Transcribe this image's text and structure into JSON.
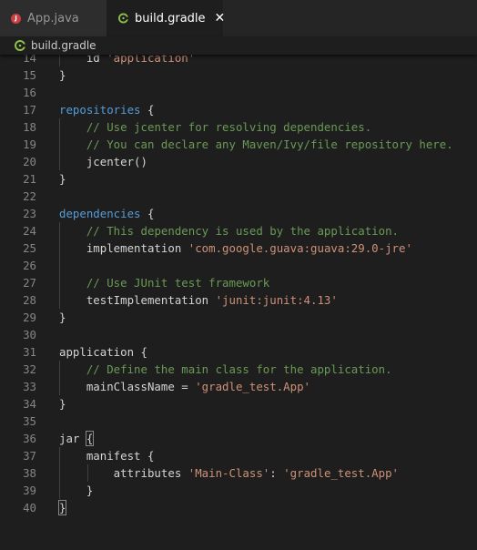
{
  "tabs": [
    {
      "label": "App.java",
      "icon": "java-file-icon",
      "icon_glyph": "J",
      "active": false
    },
    {
      "label": "build.gradle",
      "icon": "gradle-file-icon",
      "icon_glyph": "",
      "active": true,
      "close_glyph": "✕"
    }
  ],
  "breadcrumb": {
    "label": "build.gradle"
  },
  "colors": {
    "keyword": "#569cd6",
    "string": "#ce9178",
    "comment": "#6a9955",
    "text": "#d4d4d4",
    "line_number": "#858585",
    "gradle_icon": "#8dc149",
    "java_icon": "#cc3e44"
  },
  "code_lines": [
    {
      "num": "14",
      "tokens": [
        {
          "t": "    id ",
          "c": "pl"
        },
        {
          "t": "'application'",
          "c": "str"
        }
      ]
    },
    {
      "num": "15",
      "tokens": [
        {
          "t": "}",
          "c": "pl"
        }
      ]
    },
    {
      "num": "16",
      "tokens": []
    },
    {
      "num": "17",
      "tokens": [
        {
          "t": "repositories",
          "c": "kw"
        },
        {
          "t": " {",
          "c": "pl"
        }
      ]
    },
    {
      "num": "18",
      "tokens": [
        {
          "t": "    ",
          "c": "pl"
        },
        {
          "t": "// Use jcenter for resolving dependencies.",
          "c": "cm"
        }
      ]
    },
    {
      "num": "19",
      "tokens": [
        {
          "t": "    ",
          "c": "pl"
        },
        {
          "t": "// You can declare any Maven/Ivy/file repository here.",
          "c": "cm"
        }
      ]
    },
    {
      "num": "20",
      "tokens": [
        {
          "t": "    jcenter()",
          "c": "pl"
        }
      ]
    },
    {
      "num": "21",
      "tokens": [
        {
          "t": "}",
          "c": "pl"
        }
      ]
    },
    {
      "num": "22",
      "tokens": []
    },
    {
      "num": "23",
      "tokens": [
        {
          "t": "dependencies",
          "c": "kw"
        },
        {
          "t": " {",
          "c": "pl"
        }
      ]
    },
    {
      "num": "24",
      "tokens": [
        {
          "t": "    ",
          "c": "pl"
        },
        {
          "t": "// This dependency is used by the application.",
          "c": "cm"
        }
      ]
    },
    {
      "num": "25",
      "tokens": [
        {
          "t": "    implementation ",
          "c": "pl"
        },
        {
          "t": "'com.google.guava:guava:29.0-jre'",
          "c": "str"
        }
      ]
    },
    {
      "num": "26",
      "tokens": []
    },
    {
      "num": "27",
      "tokens": [
        {
          "t": "    ",
          "c": "pl"
        },
        {
          "t": "// Use JUnit test framework",
          "c": "cm"
        }
      ]
    },
    {
      "num": "28",
      "tokens": [
        {
          "t": "    testImplementation ",
          "c": "pl"
        },
        {
          "t": "'junit:junit:4.13'",
          "c": "str"
        }
      ]
    },
    {
      "num": "29",
      "tokens": [
        {
          "t": "}",
          "c": "pl"
        }
      ]
    },
    {
      "num": "30",
      "tokens": []
    },
    {
      "num": "31",
      "tokens": [
        {
          "t": "application {",
          "c": "pl"
        }
      ]
    },
    {
      "num": "32",
      "tokens": [
        {
          "t": "    ",
          "c": "pl"
        },
        {
          "t": "// Define the main class for the application.",
          "c": "cm"
        }
      ]
    },
    {
      "num": "33",
      "tokens": [
        {
          "t": "    mainClassName = ",
          "c": "pl"
        },
        {
          "t": "'gradle_test.App'",
          "c": "str"
        }
      ]
    },
    {
      "num": "34",
      "tokens": [
        {
          "t": "}",
          "c": "pl"
        }
      ]
    },
    {
      "num": "35",
      "tokens": []
    },
    {
      "num": "36",
      "tokens": [
        {
          "t": "jar ",
          "c": "pl"
        },
        {
          "t": "{",
          "c": "pl",
          "hl": true
        }
      ]
    },
    {
      "num": "37",
      "tokens": [
        {
          "t": "    manifest {",
          "c": "pl"
        }
      ]
    },
    {
      "num": "38",
      "tokens": [
        {
          "t": "        attributes ",
          "c": "pl"
        },
        {
          "t": "'Main-Class'",
          "c": "str"
        },
        {
          "t": ": ",
          "c": "pl"
        },
        {
          "t": "'gradle_test.App'",
          "c": "str"
        }
      ]
    },
    {
      "num": "39",
      "tokens": [
        {
          "t": "    }",
          "c": "pl"
        }
      ]
    },
    {
      "num": "40",
      "tokens": [
        {
          "t": "}",
          "c": "pl",
          "hl": true
        }
      ]
    }
  ]
}
